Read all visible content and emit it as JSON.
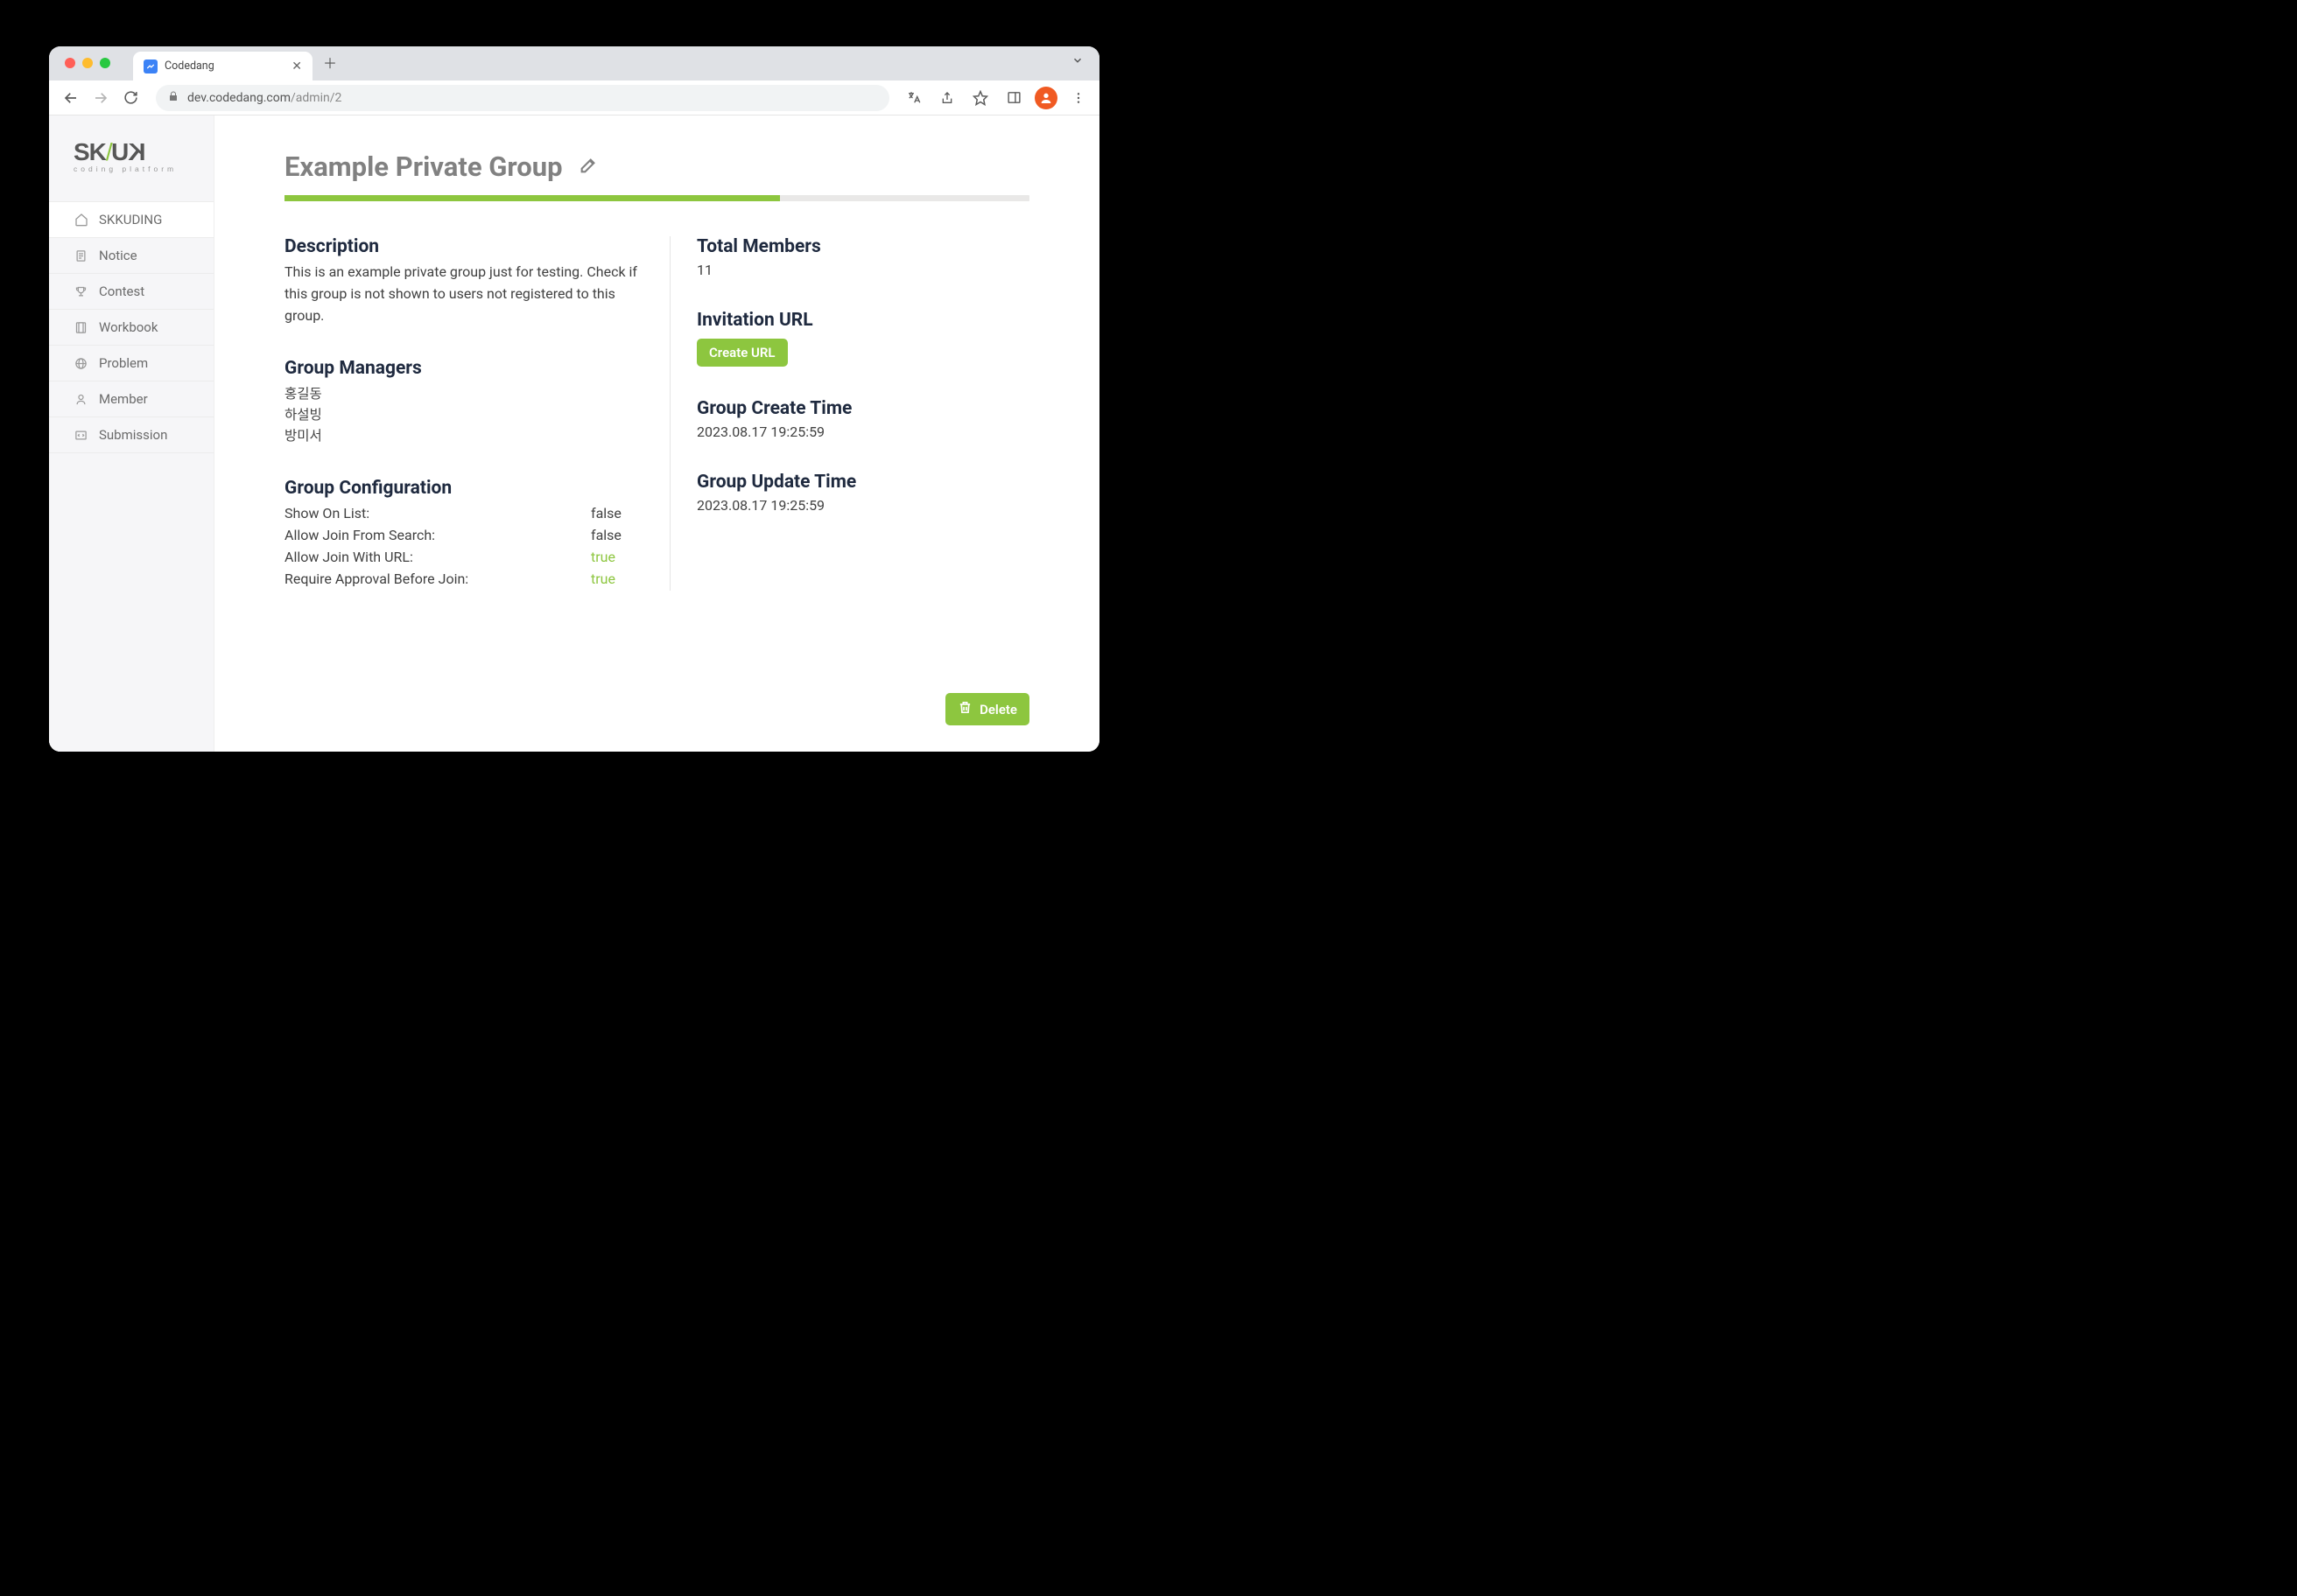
{
  "browser": {
    "tab_title": "Codedang",
    "url_host": "dev.codedang.com",
    "url_path": "/admin/2"
  },
  "logo": {
    "brand_left": "SK",
    "brand_slash": "/",
    "brand_right": "KU",
    "subtitle": "coding platform"
  },
  "sidebar": {
    "items": [
      {
        "label": "SKKUDING"
      },
      {
        "label": "Notice"
      },
      {
        "label": "Contest"
      },
      {
        "label": "Workbook"
      },
      {
        "label": "Problem"
      },
      {
        "label": "Member"
      },
      {
        "label": "Submission"
      }
    ]
  },
  "page": {
    "title": "Example Private Group",
    "progress_percent": 66.5
  },
  "description": {
    "heading": "Description",
    "text": "This is an example private group just for testing. Check if this group is not shown to users not registered to this group."
  },
  "managers": {
    "heading": "Group Managers",
    "list": [
      "홍길동",
      "하설빙",
      "방미서"
    ]
  },
  "config": {
    "heading": "Group Configuration",
    "rows": [
      {
        "label": "Show On List:",
        "value": "false",
        "is_true": false
      },
      {
        "label": "Allow Join From Search:",
        "value": "false",
        "is_true": false
      },
      {
        "label": "Allow Join With URL:",
        "value": "true",
        "is_true": true
      },
      {
        "label": "Require Approval Before Join:",
        "value": "true",
        "is_true": true
      }
    ]
  },
  "members": {
    "heading": "Total Members",
    "value": "11"
  },
  "invitation": {
    "heading": "Invitation URL",
    "button": "Create URL"
  },
  "create_time": {
    "heading": "Group Create Time",
    "value": "2023.08.17 19:25:59"
  },
  "update_time": {
    "heading": "Group Update Time",
    "value": "2023.08.17 19:25:59"
  },
  "actions": {
    "delete": "Delete"
  }
}
